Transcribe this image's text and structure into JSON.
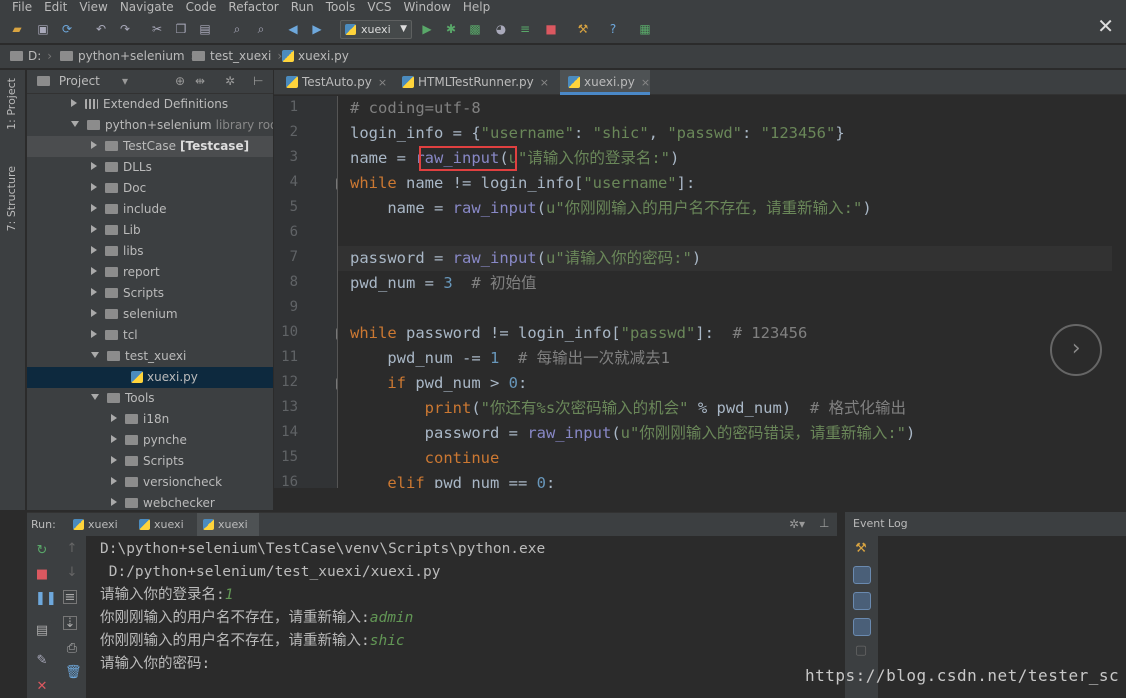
{
  "menu": [
    "File",
    "Edit",
    "View",
    "Navigate",
    "Code",
    "Refactor",
    "Run",
    "Tools",
    "VCS",
    "Window",
    "Help"
  ],
  "toolbar": {
    "run_config": "xuexi",
    "close_label": "✕"
  },
  "breadcrumb": [
    "D:",
    "python+selenium",
    "test_xuexi",
    "xuexi.py"
  ],
  "side_tabs": {
    "project": "1: Project",
    "structure": "7: Structure"
  },
  "project_panel": {
    "title": "Project",
    "items": [
      {
        "label": "Extended Definitions",
        "indent": 1,
        "expanded": false,
        "kind": "lib"
      },
      {
        "label": "python+selenium",
        "suffix": "library roo",
        "indent": 1,
        "expanded": true,
        "kind": "folder"
      },
      {
        "label": "TestCase",
        "tag": "[Testcase]",
        "indent": 2,
        "expanded": false,
        "kind": "folder"
      },
      {
        "label": "DLLs",
        "indent": 2,
        "expanded": false,
        "kind": "folder"
      },
      {
        "label": "Doc",
        "indent": 2,
        "expanded": false,
        "kind": "folder"
      },
      {
        "label": "include",
        "indent": 2,
        "expanded": false,
        "kind": "folder"
      },
      {
        "label": "Lib",
        "indent": 2,
        "expanded": false,
        "kind": "folder"
      },
      {
        "label": "libs",
        "indent": 2,
        "expanded": false,
        "kind": "folder"
      },
      {
        "label": "report",
        "indent": 2,
        "expanded": false,
        "kind": "folder"
      },
      {
        "label": "Scripts",
        "indent": 2,
        "expanded": false,
        "kind": "folder"
      },
      {
        "label": "selenium",
        "indent": 2,
        "expanded": false,
        "kind": "folder"
      },
      {
        "label": "tcl",
        "indent": 2,
        "expanded": false,
        "kind": "folder"
      },
      {
        "label": "test_xuexi",
        "indent": 2,
        "expanded": true,
        "kind": "folder"
      },
      {
        "label": "xuexi.py",
        "indent": 3,
        "kind": "file",
        "selected": true
      },
      {
        "label": "Tools",
        "indent": 2,
        "expanded": true,
        "kind": "folder"
      },
      {
        "label": "i18n",
        "indent": 3,
        "expanded": false,
        "kind": "folder"
      },
      {
        "label": "pynche",
        "indent": 3,
        "expanded": false,
        "kind": "folder"
      },
      {
        "label": "Scripts",
        "indent": 3,
        "expanded": false,
        "kind": "folder"
      },
      {
        "label": "versioncheck",
        "indent": 3,
        "expanded": false,
        "kind": "folder"
      },
      {
        "label": "webchecker",
        "indent": 3,
        "expanded": false,
        "kind": "folder"
      }
    ]
  },
  "editor_tabs": [
    {
      "label": "TestAuto.py",
      "active": false
    },
    {
      "label": "HTMLTestRunner.py",
      "active": false
    },
    {
      "label": "xuexi.py",
      "active": true
    }
  ],
  "code_lines": [
    {
      "n": "1",
      "html": "<span class='cm'># coding=utf-8</span>"
    },
    {
      "n": "2",
      "html": "login_info = {<span class='st'>\"username\"</span>: <span class='st'>\"shic\"</span>, <span class='st'>\"passwd\"</span>: <span class='st'>\"123456\"</span>}"
    },
    {
      "n": "3",
      "html": "name = <span class='fn'>raw_input</span>(<span class='st'>u\"请输入你的登录名:\"</span>)"
    },
    {
      "n": "4",
      "html": "<span class='kw'>while</span> name != login_info[<span class='st'>\"username\"</span>]:"
    },
    {
      "n": "5",
      "html": "    name = <span class='fn'>raw_input</span>(<span class='st'>u\"你刚刚输入的用户名不存在，请重新输入:\"</span>)"
    },
    {
      "n": "6",
      "html": ""
    },
    {
      "n": "7",
      "html": "password = <span class='fn'>raw_input</span>(<span class='st'>u\"请输入你的密码:\"</span>)"
    },
    {
      "n": "8",
      "html": "pwd_num = <span class='nm'>3</span>  <span class='cm'># 初始值</span>"
    },
    {
      "n": "9",
      "html": ""
    },
    {
      "n": "10",
      "html": "<span class='kw'>while</span> password != login_info[<span class='st'>\"passwd\"</span>]:  <span class='cm'># 123456</span>"
    },
    {
      "n": "11",
      "html": "    pwd_num -= <span class='nm'>1</span>  <span class='cm'># 每输出一次就减去1</span>"
    },
    {
      "n": "12",
      "html": "    <span class='kw'>if</span> pwd_num &gt; <span class='nm'>0</span>:"
    },
    {
      "n": "13",
      "html": "        <span class='kw'>print</span>(<span class='st'>\"你还有%s次密码输入的机会\"</span> % pwd_num)  <span class='cm'># 格式化输出</span>"
    },
    {
      "n": "14",
      "html": "        password = <span class='fn'>raw_input</span>(<span class='st'>u\"你刚刚输入的密码错误，请重新输入:\"</span>)"
    },
    {
      "n": "15",
      "html": "        <span class='kw'>continue</span>"
    },
    {
      "n": "16",
      "html": "    <span class='kw'>elif</span> pwd_num == <span class='nm'>0</span>:"
    }
  ],
  "run_panel": {
    "label": "Run:",
    "tabs": [
      {
        "label": "xuexi",
        "active": false
      },
      {
        "label": "xuexi",
        "active": false
      },
      {
        "label": "xuexi",
        "active": true
      }
    ],
    "console": [
      {
        "text": "D:\\python+selenium\\TestCase\\venv\\Scripts\\python.exe",
        "input": ""
      },
      {
        "text": " D:/python+selenium/test_xuexi/xuexi.py",
        "input": ""
      },
      {
        "text": "请输入你的登录名:",
        "input": "1"
      },
      {
        "text": "你刚刚输入的用户名不存在，请重新输入:",
        "input": "admin"
      },
      {
        "text": "你刚刚输入的用户名不存在，请重新输入:",
        "input": "shic"
      },
      {
        "text": "请输入你的密码:",
        "input": ""
      }
    ]
  },
  "event_log": {
    "title": "Event Log"
  },
  "watermark": "https://blog.csdn.net/tester_sc"
}
